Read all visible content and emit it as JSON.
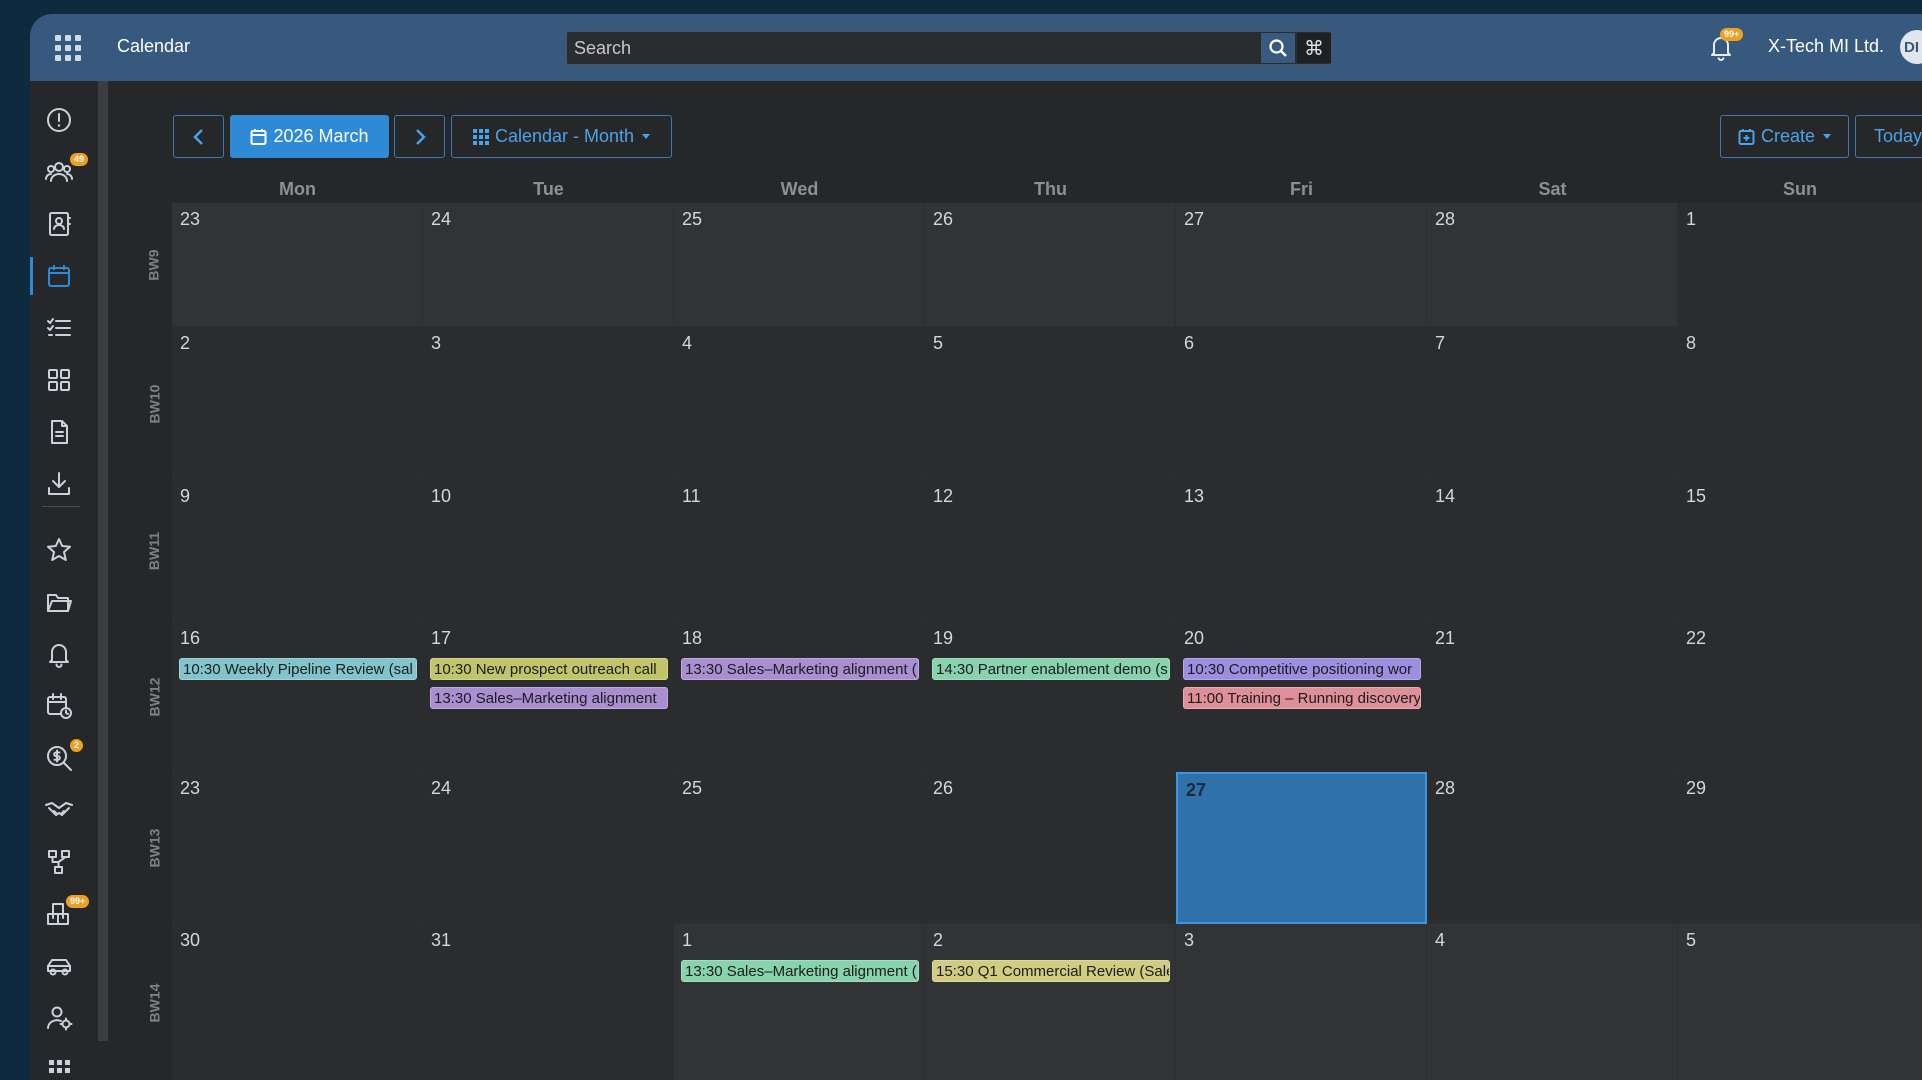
{
  "app": {
    "title": "Calendar",
    "company": "X-Tech MI Ltd.",
    "avatar_initials": "DI",
    "notifications_badge": "99+"
  },
  "search": {
    "placeholder": "Search"
  },
  "sidebar": {
    "items": [
      {
        "icon": "info-circle-icon",
        "badge": ""
      },
      {
        "icon": "users-icon",
        "badge": "49"
      },
      {
        "icon": "contact-book-icon",
        "badge": ""
      },
      {
        "icon": "calendar-icon",
        "badge": "",
        "active": true
      },
      {
        "icon": "task-list-icon",
        "badge": ""
      },
      {
        "icon": "dashboard-icon",
        "badge": ""
      },
      {
        "icon": "document-icon",
        "badge": ""
      },
      {
        "icon": "download-icon",
        "badge": ""
      },
      {
        "icon": "star-icon",
        "badge": ""
      },
      {
        "icon": "folder-icon",
        "badge": ""
      },
      {
        "icon": "bell-icon",
        "badge": ""
      },
      {
        "icon": "calendar-clock-icon",
        "badge": ""
      },
      {
        "icon": "money-search-icon",
        "badge": "2"
      },
      {
        "icon": "handshake-icon",
        "badge": ""
      },
      {
        "icon": "hierarchy-icon",
        "badge": ""
      },
      {
        "icon": "boxes-icon",
        "badge": "99+"
      },
      {
        "icon": "car-icon",
        "badge": ""
      },
      {
        "icon": "user-settings-icon",
        "badge": ""
      },
      {
        "icon": "more-apps-icon",
        "badge": ""
      }
    ]
  },
  "toolbar": {
    "prev_label": "‹",
    "month_label": "2026 March",
    "next_label": "›",
    "view_label": "Calendar - Month",
    "create_label": "Create",
    "today_label": "Today"
  },
  "calendar": {
    "weekdays": [
      "Mon",
      "Tue",
      "Wed",
      "Thu",
      "Fri",
      "Sat",
      "Sun"
    ],
    "weeks": [
      {
        "label": "BW9",
        "days": [
          {
            "n": "23",
            "other": true
          },
          {
            "n": "24",
            "other": true
          },
          {
            "n": "25",
            "other": true
          },
          {
            "n": "26",
            "other": true
          },
          {
            "n": "27",
            "other": true
          },
          {
            "n": "28",
            "other": true
          },
          {
            "n": "1"
          }
        ]
      },
      {
        "label": "BW10",
        "days": [
          {
            "n": "2"
          },
          {
            "n": "3"
          },
          {
            "n": "4"
          },
          {
            "n": "5"
          },
          {
            "n": "6"
          },
          {
            "n": "7"
          },
          {
            "n": "8"
          }
        ]
      },
      {
        "label": "BW11",
        "days": [
          {
            "n": "9"
          },
          {
            "n": "10"
          },
          {
            "n": "11"
          },
          {
            "n": "12"
          },
          {
            "n": "13"
          },
          {
            "n": "14"
          },
          {
            "n": "15"
          }
        ]
      },
      {
        "label": "BW12",
        "days": [
          {
            "n": "16",
            "events": [
              {
                "text": "10:30 Weekly Pipeline Review (sal",
                "color": "#82c4cc"
              }
            ]
          },
          {
            "n": "17",
            "events": [
              {
                "text": "10:30 New prospect outreach call",
                "color": "#c2c46a"
              },
              {
                "text": "13:30 Sales–Marketing alignment",
                "color": "#a98fd2"
              }
            ]
          },
          {
            "n": "18",
            "events": [
              {
                "text": "13:30 Sales–Marketing alignment (",
                "color": "#a98fd2"
              }
            ]
          },
          {
            "n": "19",
            "events": [
              {
                "text": "14:30 Partner enablement demo (s",
                "color": "#86d3ad"
              }
            ]
          },
          {
            "n": "20",
            "events": [
              {
                "text": "10:30 Competitive positioning wor",
                "color": "#9c8ee0"
              },
              {
                "text": "11:00 Training – Running discovery",
                "color": "#de8f9a"
              }
            ]
          },
          {
            "n": "21"
          },
          {
            "n": "22"
          }
        ]
      },
      {
        "label": "BW13",
        "days": [
          {
            "n": "23"
          },
          {
            "n": "24"
          },
          {
            "n": "25"
          },
          {
            "n": "26"
          },
          {
            "n": "27",
            "today": true
          },
          {
            "n": "28"
          },
          {
            "n": "29"
          }
        ]
      },
      {
        "label": "BW14",
        "days": [
          {
            "n": "30"
          },
          {
            "n": "31"
          },
          {
            "n": "1",
            "other": true,
            "events": [
              {
                "text": "13:30 Sales–Marketing alignment (",
                "color": "#86d3ad"
              }
            ]
          },
          {
            "n": "2",
            "other": true,
            "events": [
              {
                "text": "15:30 Q1 Commercial Review (Sale",
                "color": "#d1cc80"
              }
            ]
          },
          {
            "n": "3",
            "other": true
          },
          {
            "n": "4",
            "other": true
          },
          {
            "n": "5",
            "other": true
          }
        ]
      }
    ]
  }
}
